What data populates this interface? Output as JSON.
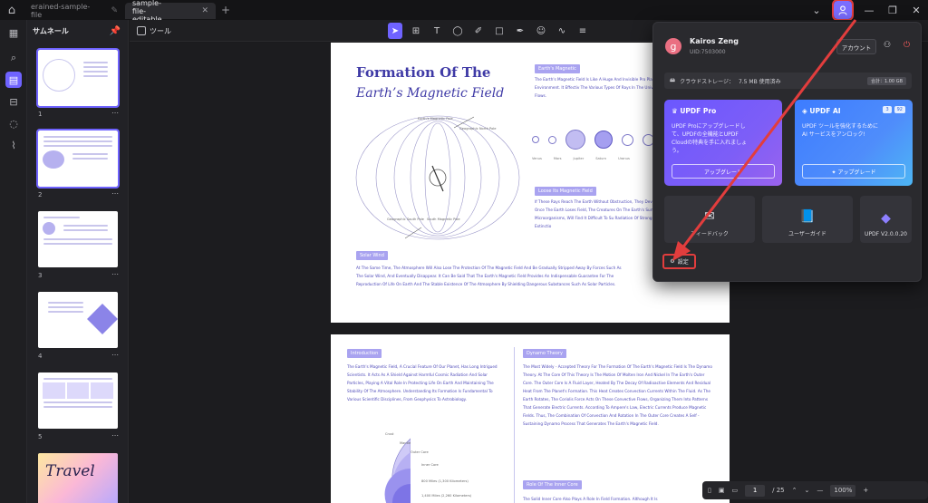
{
  "titlebar": {
    "tabs": [
      {
        "label": "erained-sample-file",
        "active": false
      },
      {
        "label": "sample-file-editable",
        "active": true
      }
    ],
    "add_tab": "+",
    "close": "✕"
  },
  "thumbnails": {
    "title": "サムネール",
    "pages": [
      "1",
      "2",
      "3",
      "4",
      "5"
    ],
    "more": "⋯",
    "thumb5_text": "Travel"
  },
  "toolbar": {
    "tools_label": "ツール"
  },
  "page1": {
    "title": "Formation Of The",
    "subtitle": "Earth’s Magnetic Field",
    "tag_magnetic": "Earth's Magnetic",
    "magnetic_text": "The Earth's Magnetic Field Is Like A Huge And Invisible Pro Playing A Vital Role In This Cosmic Environment. It Effectiv The Various Types Of Rays In The Universe, Such As Hi Charged Particle Flows.",
    "planet_labels": [
      "Venus",
      "Mars",
      "Jupiter",
      "Saturn",
      "Uranus"
    ],
    "tag_loose": "Loose Its Magnetic Field",
    "loose_text": "If These Rays Reach The Earth Without Obstruction, They Devastating Blow To Life On Earth. Once The Earth Loses Field, The Creatures On The Earth's Surface, Whether Ca Animals Or Tiny Microorganisms, Will Find It Difficult To Su Radiation Of Strong Rays And Will Quickly Go To Extinctio",
    "tag_solar": "Solar Wind",
    "solar_text": "At The Same Time, The Atmosphere Will Also Lose The Protection Of The Magnetic Field And Be Gradually Stripped Away By Forces Such As The Solar Wind, And Eventually Disappear. It Can Be Said That The Earth's Magnetic Field Provides An Indispensable Guarantee For The Reproduction Of Life On Earth And The Stable Existence Of The Atmosphere By Shielding Dangerous Substances Such As Solar Particles.",
    "diagram_labels": {
      "earth_north": "Earth's Magnetic Pole",
      "geo_north": "Geographic North Pole",
      "geo_south": "Geographic South Pole",
      "south_mag": "South Magnetic Pole"
    }
  },
  "page2": {
    "tag_intro": "Introduction",
    "intro_text": "The Earth's Magnetic Field, A Crucial Feature Of Our Planet, Has Long Intrigued Scientists. It Acts As A Shield Against Harmful Cosmic Radiation And Solar Particles, Playing A Vital Role In Protecting Life On Earth And Maintaining The Stability Of The Atmosphere. Understanding Its Formation Is Fundamental To Various Scientific Disciplines, From Geophysics To Astrobiology.",
    "tag_dynamo": "Dynamo Theory",
    "dynamo_text": "The Most Widely - Accepted Theory For The Formation Of The Earth's Magnetic Field Is The Dynamo Theory. At The Core Of This Theory Is The Motion Of Molten Iron And Nickel In The Earth's Outer Core. The Outer Core Is A Fluid Layer, Heated By The Decay Of Radioactive Elements And Residual Heat From The Planet's Formation. This Heat Creates Convection Currents Within The Fluid. As The Earth Rotates, The Coriolis Force Acts On These Convective Flows, Organizing Them Into Patterns That Generate Electric Currents. According To Ampere's Law, Electric Currents Produce Magnetic Fields. Thus, The Combination Of Convection And Rotation In The Outer Core Creates A Self - Sustaining Dynamo Process That Generates The Earth's Magnetic Field.",
    "tag_inner": "Role Of The Inner Core",
    "inner_text": "The Solid Inner Core Also Plays A Role In Field Formation. Although It Is",
    "core_labels": [
      "Crust",
      "Mantle",
      "Outer Core",
      "Inner Core",
      "800 Miles (1,300 Kilometers)",
      "1,400 Miles (2,260 Kilometers)"
    ]
  },
  "account": {
    "avatar_letter": "g",
    "name": "Kairos Zeng",
    "uid": "UID:7503000",
    "account_button": "アカウント",
    "storage_label": "クラウドストレージ：",
    "storage_value": "7.5 MB 使用済み",
    "storage_total": "合計：1.00 GB",
    "pro_title": "UPDF Pro",
    "pro_desc": "UPDF Proにアップグレードして、UPDFの全機能とUPDF Cloudの特典を手に入れましょう。",
    "pro_button": "アップグレード",
    "ai_title": "UPDF AI",
    "ai_badge1": "3",
    "ai_badge2": "92",
    "ai_desc": "UPDF ツールを強化するために AI サービスをアンロック!",
    "ai_button": "✦ アップグレード",
    "tile_feedback": "フィードバック",
    "tile_guide": "ユーザーガイド",
    "tile_version": "UPDF V2.0.0.20",
    "settings_label": "設定"
  },
  "status": {
    "page_current": "1",
    "page_total": "/ 25",
    "zoom": "100%"
  },
  "colors": {
    "accent": "#6f63ff",
    "highlight": "#e23d3d",
    "doc_purple": "#3f3aa6"
  }
}
